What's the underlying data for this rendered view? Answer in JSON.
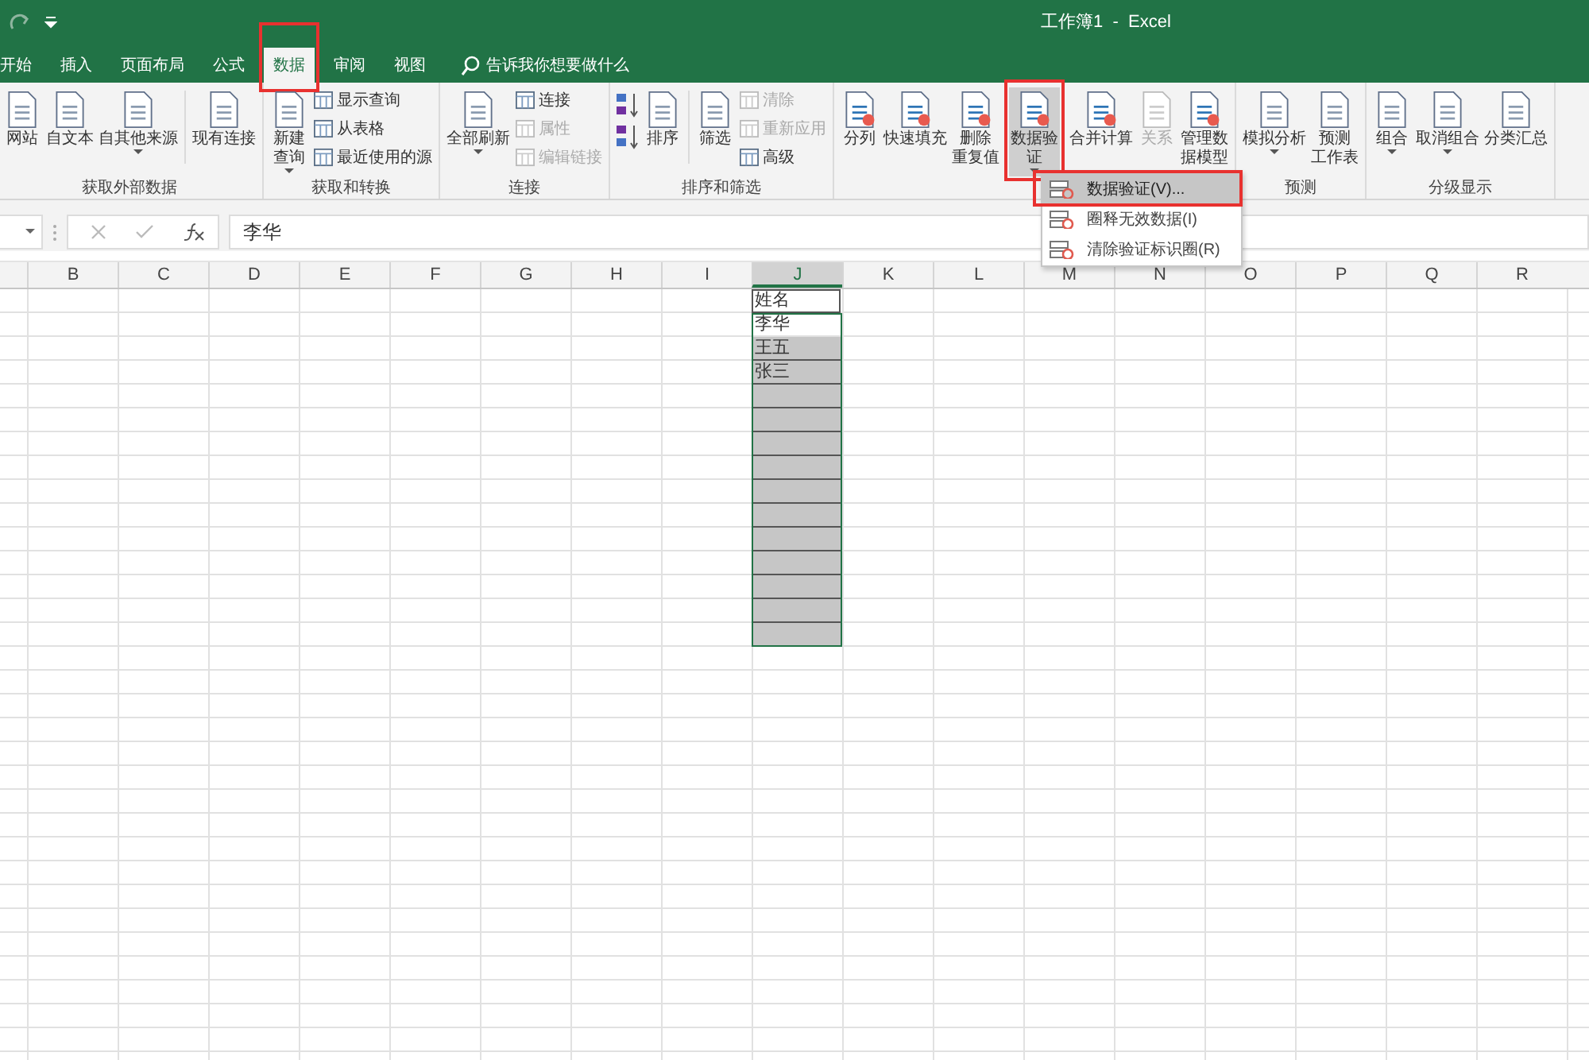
{
  "window": {
    "title": "工作簿1  -  Excel"
  },
  "tabs": [
    {
      "label": "开始",
      "selected": false,
      "highlighted": false
    },
    {
      "label": "插入",
      "selected": false,
      "highlighted": false
    },
    {
      "label": "页面布局",
      "selected": false,
      "highlighted": false
    },
    {
      "label": "公式",
      "selected": false,
      "highlighted": false
    },
    {
      "label": "数据",
      "selected": true,
      "highlighted": true
    },
    {
      "label": "审阅",
      "selected": false,
      "highlighted": false
    },
    {
      "label": "视图",
      "selected": false,
      "highlighted": false
    }
  ],
  "tell_me": {
    "placeholder": "告诉我你想要做什么"
  },
  "ribbon_groups": [
    {
      "label": "获取外部数据",
      "items": [
        {
          "kind": "large",
          "label": [
            "网站"
          ],
          "caret": false,
          "disabled": false,
          "highlighted": false
        },
        {
          "kind": "large",
          "label": [
            "自文本"
          ],
          "caret": false,
          "disabled": false,
          "highlighted": false
        },
        {
          "kind": "large",
          "label": [
            "自其他来源"
          ],
          "caret": true,
          "disabled": false,
          "highlighted": false
        },
        {
          "kind": "separator"
        },
        {
          "kind": "large",
          "label": [
            "现有连接"
          ],
          "caret": false,
          "disabled": false,
          "highlighted": false
        }
      ]
    },
    {
      "label": "获取和转换",
      "items": [
        {
          "kind": "large",
          "label": [
            "新建",
            "查询"
          ],
          "caret": true,
          "disabled": false,
          "highlighted": false
        },
        {
          "kind": "stack",
          "items": [
            {
              "label": "显示查询",
              "disabled": false
            },
            {
              "label": "从表格",
              "disabled": false
            },
            {
              "label": "最近使用的源",
              "disabled": false
            }
          ]
        }
      ]
    },
    {
      "label": "连接",
      "items": [
        {
          "kind": "large",
          "label": [
            "全部刷新"
          ],
          "caret": true,
          "disabled": false,
          "highlighted": false
        },
        {
          "kind": "stack",
          "items": [
            {
              "label": "连接",
              "disabled": false
            },
            {
              "label": "属性",
              "disabled": true
            },
            {
              "label": "编辑链接",
              "disabled": true
            }
          ]
        }
      ]
    },
    {
      "label": "排序和筛选",
      "items": [
        {
          "kind": "sort"
        },
        {
          "kind": "large",
          "label": [
            "排序"
          ],
          "caret": false,
          "disabled": false,
          "highlighted": false
        },
        {
          "kind": "separator"
        },
        {
          "kind": "large",
          "label": [
            "筛选"
          ],
          "caret": false,
          "disabled": false,
          "highlighted": false
        },
        {
          "kind": "stack",
          "items": [
            {
              "label": "清除",
              "disabled": true
            },
            {
              "label": "重新应用",
              "disabled": true
            },
            {
              "label": "高级",
              "disabled": false
            }
          ]
        }
      ]
    },
    {
      "items": [
        {
          "kind": "large",
          "label": [
            "分列"
          ],
          "caret": false,
          "disabled": false,
          "highlighted": false
        },
        {
          "kind": "large",
          "label": [
            "快速填充"
          ],
          "caret": false,
          "disabled": false,
          "highlighted": false
        },
        {
          "kind": "large",
          "label": [
            "删除",
            "重复值"
          ],
          "caret": false,
          "disabled": false,
          "highlighted": false
        },
        {
          "kind": "large",
          "label": [
            "数据验",
            "证"
          ],
          "caret": true,
          "disabled": false,
          "highlighted": true
        },
        {
          "kind": "large",
          "label": [
            "合并计算"
          ],
          "caret": false,
          "disabled": false,
          "highlighted": false
        },
        {
          "kind": "large",
          "label": [
            "关系"
          ],
          "caret": false,
          "disabled": true,
          "highlighted": false
        },
        {
          "kind": "large",
          "label": [
            "管理数",
            "据模型"
          ],
          "caret": false,
          "disabled": false,
          "highlighted": false
        }
      ]
    },
    {
      "label": "预测",
      "items": [
        {
          "kind": "large",
          "label": [
            "模拟分析"
          ],
          "caret": true,
          "disabled": false,
          "highlighted": false
        },
        {
          "kind": "large",
          "label": [
            "预测",
            "工作表"
          ],
          "caret": false,
          "disabled": false,
          "highlighted": false
        }
      ]
    },
    {
      "label": "分级显示",
      "items": [
        {
          "kind": "large",
          "label": [
            "组合"
          ],
          "caret": true,
          "disabled": false,
          "highlighted": false
        },
        {
          "kind": "large",
          "label": [
            "取消组合"
          ],
          "caret": true,
          "disabled": false,
          "highlighted": false
        },
        {
          "kind": "large",
          "label": [
            "分类汇总"
          ],
          "caret": false,
          "disabled": false,
          "highlighted": false
        }
      ]
    }
  ],
  "dropdown_menu": [
    {
      "label": "数据验证(V)...",
      "selected": true,
      "highlighted": true
    },
    {
      "label": "圈释无效数据(I)",
      "selected": false,
      "highlighted": false
    },
    {
      "label": "清除验证标识圈(R)",
      "selected": false,
      "highlighted": false
    }
  ],
  "formula_bar": {
    "value": "李华"
  },
  "sheet": {
    "columns": [
      "B",
      "C",
      "D",
      "E",
      "F",
      "G",
      "H",
      "I",
      "J",
      "K",
      "L",
      "M",
      "N",
      "O",
      "P",
      "Q",
      "R"
    ],
    "column_j": [
      {
        "value": "姓名",
        "selected": false,
        "active": false
      },
      {
        "value": "李华",
        "selected": true,
        "active": true
      },
      {
        "value": "王五",
        "selected": true,
        "active": false
      },
      {
        "value": "张三",
        "selected": true,
        "active": false
      },
      {
        "selected": true,
        "active": false
      },
      {
        "selected": true,
        "active": false
      },
      {
        "selected": true,
        "active": false
      },
      {
        "selected": true,
        "active": false
      },
      {
        "selected": true,
        "active": false
      },
      {
        "selected": true,
        "active": false
      },
      {
        "selected": true,
        "active": false
      },
      {
        "selected": true,
        "active": false
      },
      {
        "selected": true,
        "active": false
      },
      {
        "selected": true,
        "active": false
      },
      {
        "selected": true,
        "active": false
      }
    ]
  }
}
